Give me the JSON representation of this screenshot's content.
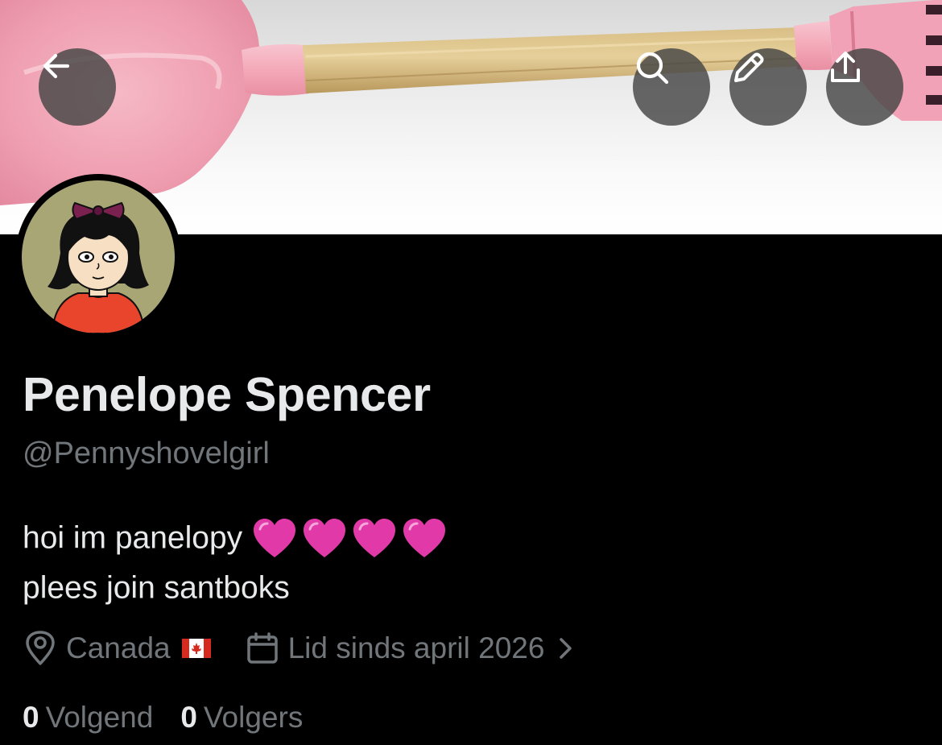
{
  "profile": {
    "display_name": "Penelope Spencer",
    "handle": "@Pennyshovelgirl",
    "bio_line1": "hoi im panelopy",
    "bio_hearts": [
      "pink-heart",
      "pink-heart",
      "pink-heart",
      "pink-heart"
    ],
    "bio_line2": "plees join santboks",
    "location": "Canada",
    "location_flag": "canada-flag",
    "joined": "Lid sinds april 2026",
    "following_count": "0",
    "following_label": "Volgend",
    "followers_count": "0",
    "followers_label": "Volgers"
  },
  "header_buttons": {
    "back": "arrow-left-icon",
    "search": "search-icon",
    "edit": "pencil-icon",
    "share": "share-icon"
  },
  "colors": {
    "background": "#000000",
    "primary_text": "#e7e9ea",
    "secondary_text": "#71767b",
    "heart": "#e13aa8",
    "button_bg": "#464646"
  }
}
